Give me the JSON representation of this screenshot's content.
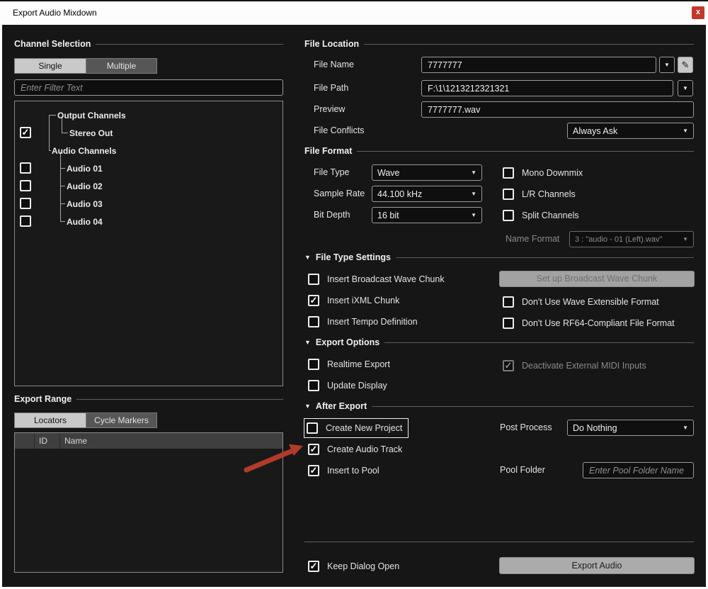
{
  "window": {
    "title": "Export Audio Mixdown"
  },
  "icons": {
    "close": "x",
    "dropdown_arrow": "▼",
    "section_arrow": "▼",
    "pencil": "✎",
    "check": "✓"
  },
  "colors": {
    "close_button": "#c0392b",
    "annotation_arrow": "#b23b2c",
    "dialog_background": "#161616"
  },
  "channel_selection": {
    "title": "Channel Selection",
    "tabs": [
      "Single",
      "Multiple"
    ],
    "filter_placeholder": "Enter Filter Text",
    "tree": [
      {
        "label": "Output Channels"
      },
      {
        "label": "Stereo Out",
        "checked": true
      },
      {
        "label": "Audio Channels"
      },
      {
        "label": "Audio 01",
        "checked": false
      },
      {
        "label": "Audio 02",
        "checked": false
      },
      {
        "label": "Audio 03",
        "checked": false
      },
      {
        "label": "Audio 04",
        "checked": false
      }
    ]
  },
  "export_range": {
    "title": "Export Range",
    "tabs": [
      "Locators",
      "Cycle Markers"
    ],
    "columns": [
      "ID",
      "Name"
    ]
  },
  "file_location": {
    "title": "File Location",
    "file_name": {
      "label": "File Name",
      "value": "7777777"
    },
    "file_path": {
      "label": "File Path",
      "value": "F:\\1\\1213212321321"
    },
    "preview": {
      "label": "Preview",
      "value": "7777777.wav"
    },
    "file_conflicts": {
      "label": "File Conflicts",
      "value": "Always Ask"
    }
  },
  "file_format": {
    "title": "File Format",
    "file_type": {
      "label": "File Type",
      "value": "Wave"
    },
    "sample_rate": {
      "label": "Sample Rate",
      "value": "44.100 kHz"
    },
    "bit_depth": {
      "label": "Bit Depth",
      "value": "16 bit"
    },
    "mono_downmix": "Mono Downmix",
    "lr_channels": "L/R Channels",
    "split_channels": "Split Channels",
    "name_format": {
      "label": "Name Format",
      "value": "3 : \"audio - 01 (Left).wav\""
    }
  },
  "file_type_settings": {
    "title": "File Type Settings",
    "insert_broadcast_wave_chunk": "Insert Broadcast Wave Chunk",
    "insert_ixml_chunk": "Insert iXML Chunk",
    "insert_tempo_definition": "Insert Tempo Definition",
    "set_up_broadcast_wave_chunk": "Set up Broadcast Wave Chunk",
    "dont_use_wave_extensible_format": "Don't Use Wave Extensible Format",
    "dont_use_rf64_compliant_file_format": "Don't Use RF64-Compliant File Format"
  },
  "export_options": {
    "title": "Export Options",
    "realtime_export": "Realtime Export",
    "update_display": "Update Display",
    "deactivate_external_midi_inputs": "Deactivate External MIDI Inputs"
  },
  "after_export": {
    "title": "After Export",
    "create_new_project": "Create New Project",
    "create_audio_track": "Create Audio Track",
    "insert_to_pool": "Insert to Pool",
    "post_process": {
      "label": "Post Process",
      "value": "Do Nothing"
    },
    "pool_folder": {
      "label": "Pool Folder",
      "placeholder": "Enter Pool Folder Name"
    }
  },
  "footer": {
    "keep_dialog_open": "Keep Dialog Open",
    "export_audio": "Export Audio"
  }
}
